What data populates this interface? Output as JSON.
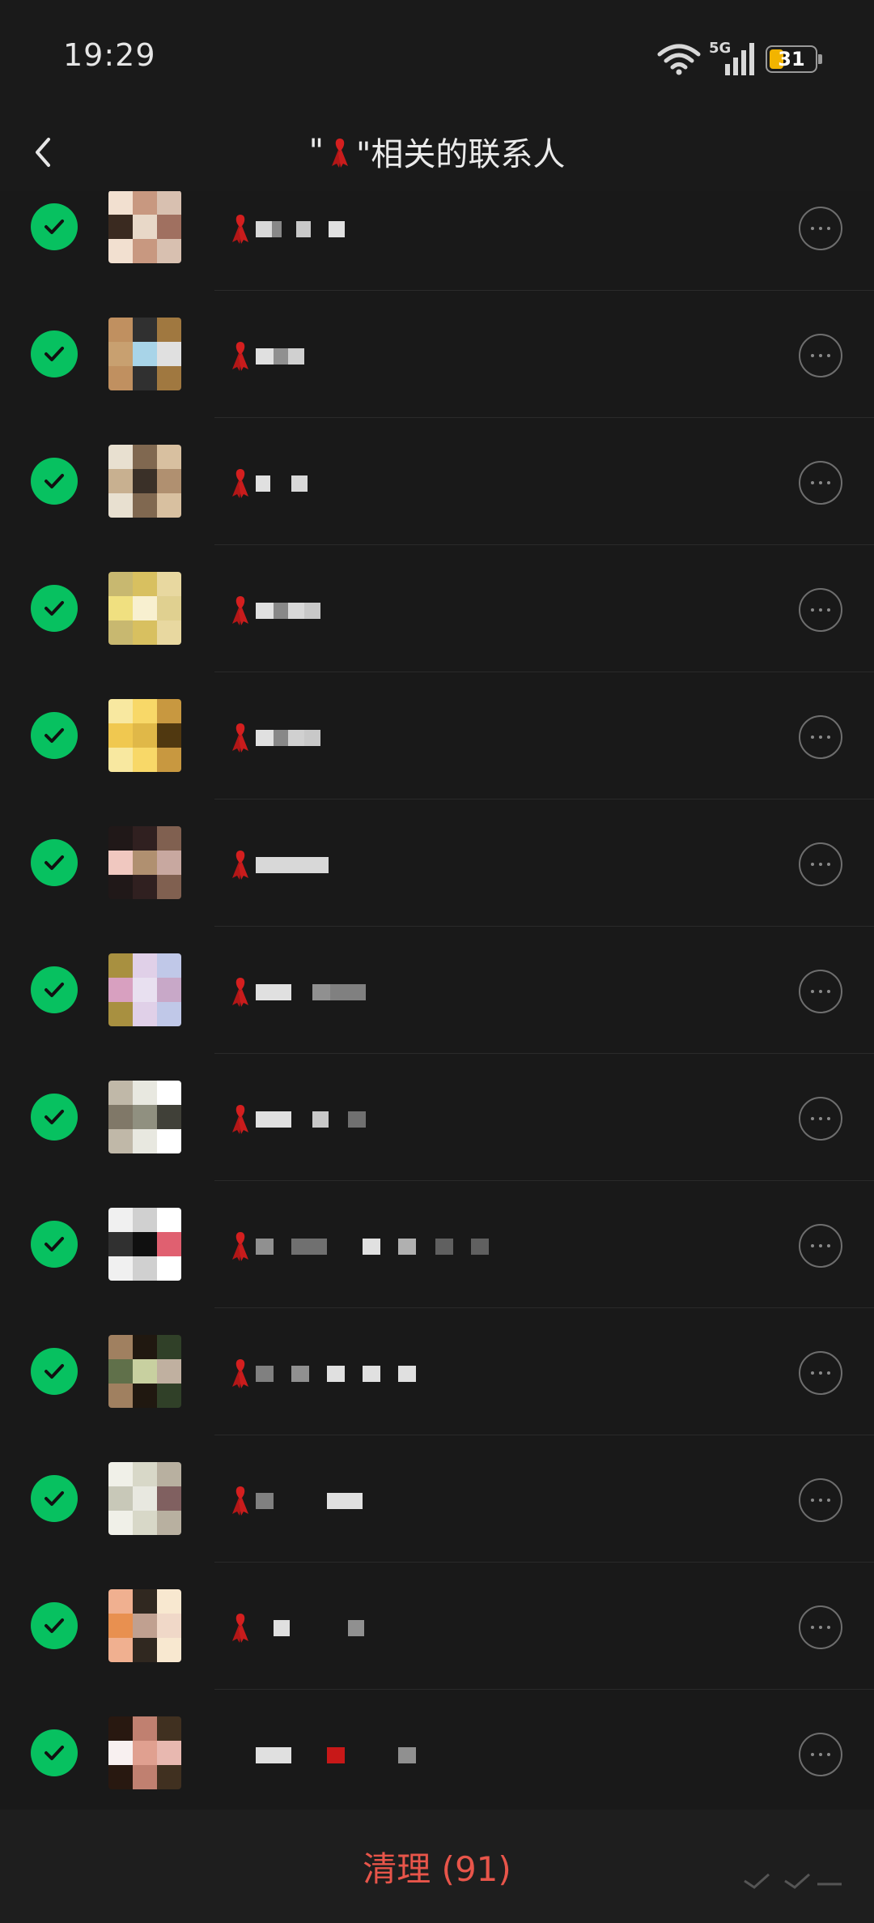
{
  "status_bar": {
    "time": "19:29",
    "network": "5G",
    "battery": "31",
    "battery_level": 0.31,
    "icons": [
      "wifi-icon",
      "5g-signal-icon",
      "battery-icon"
    ]
  },
  "header": {
    "title_prefix": "\"",
    "title_suffix": "\"相关的联系人",
    "title_icon": "red-ribbon-icon",
    "back_icon": "back-chevron-icon"
  },
  "contacts": [
    {
      "checked": true,
      "label_icon": "red-ribbon-icon"
    },
    {
      "checked": true,
      "label_icon": "red-ribbon-icon"
    },
    {
      "checked": true,
      "label_icon": "red-ribbon-icon"
    },
    {
      "checked": true,
      "label_icon": "red-ribbon-icon"
    },
    {
      "checked": true,
      "label_icon": "red-ribbon-icon"
    },
    {
      "checked": true,
      "label_icon": "red-ribbon-icon"
    },
    {
      "checked": true,
      "label_icon": "red-ribbon-icon"
    },
    {
      "checked": true,
      "label_icon": "red-ribbon-icon"
    },
    {
      "checked": true,
      "label_icon": "red-ribbon-icon"
    },
    {
      "checked": true,
      "label_icon": "red-ribbon-icon"
    },
    {
      "checked": true,
      "label_icon": "red-ribbon-icon"
    },
    {
      "checked": true,
      "label_icon": "red-ribbon-icon"
    },
    {
      "checked": true,
      "label_icon": ""
    }
  ],
  "footer": {
    "clean_button_label": "清理 (91)"
  },
  "colors": {
    "accent_green": "#07c160",
    "danger_red": "#e8554a",
    "background": "#191919",
    "battery_yellow": "#f2b400"
  }
}
